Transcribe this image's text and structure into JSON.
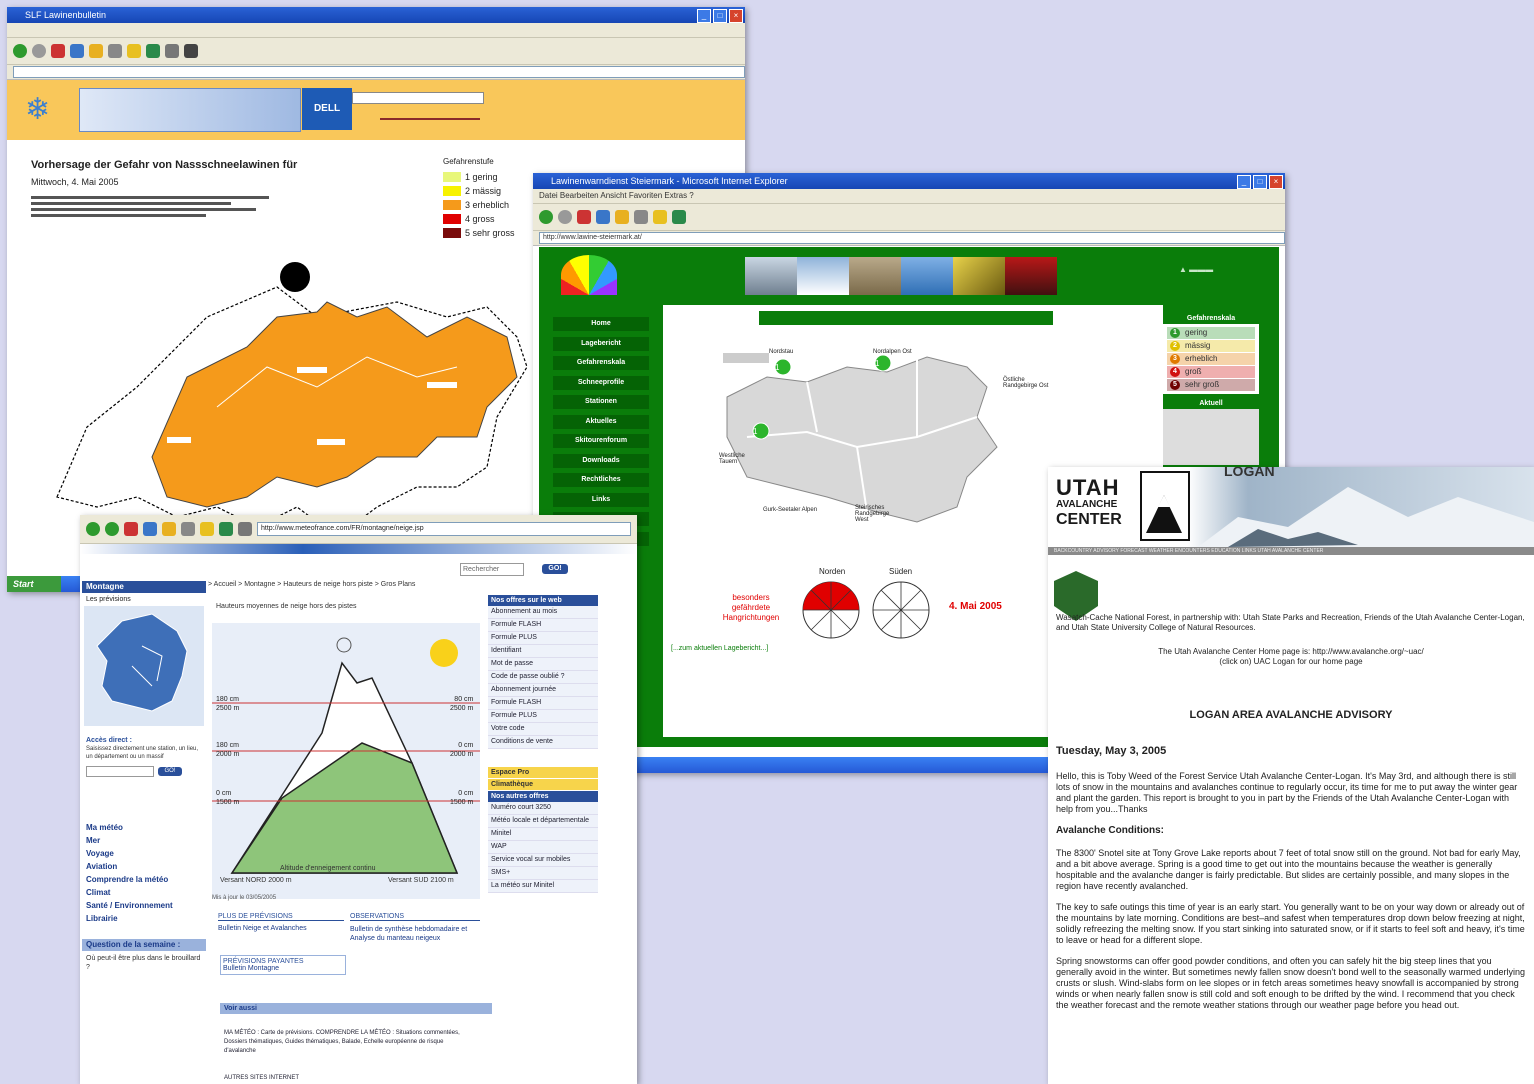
{
  "w1": {
    "title_bar": "SLF Lawinenbulletin",
    "map_title": "Vorhersage der Gefahr von Nassschneelawinen für",
    "map_subtitle": "Mittwoch, 4. Mai 2005",
    "legend_title": "Gefahrenstufe",
    "legend": [
      {
        "label": "1 gering",
        "color": "#e8f77a"
      },
      {
        "label": "2 mässig",
        "color": "#f7f200"
      },
      {
        "label": "3 erheblich",
        "color": "#f59a1b"
      },
      {
        "label": "4 gross",
        "color": "#e00000"
      },
      {
        "label": "5 sehr gross",
        "color": "#7a0b0b"
      }
    ],
    "region_color": "#f59a1b",
    "start_label": "Start"
  },
  "w2": {
    "title_bar": "Lawinenwarndienst Steiermark - Microsoft Internet Explorer",
    "menu": "Datei  Bearbeiten  Ansicht  Favoriten  Extras  ?",
    "address": "http://www.lawine-steiermark.at/",
    "nav": [
      "Home",
      "Lagebericht",
      "Gefahrenskala",
      "Schneeprofile",
      "Stationen",
      "Aktuelles",
      "Skitourenforum",
      "Downloads",
      "Rechtliches",
      "Links",
      "Team",
      "Kontakt"
    ],
    "gefahr_title": "Gefahrenskala",
    "gefahr_levels": [
      {
        "num": "1",
        "label": "gering",
        "color": "#2c9a2c"
      },
      {
        "num": "2",
        "label": "mässig",
        "color": "#e0c000"
      },
      {
        "num": "3",
        "label": "erheblich",
        "color": "#e07a00"
      },
      {
        "num": "4",
        "label": "groß",
        "color": "#d01010"
      },
      {
        "num": "5",
        "label": "sehr groß",
        "color": "#700000"
      }
    ],
    "aktuell_label": "Aktuell",
    "north_label": "Norden",
    "south_label": "Süden",
    "special_label": "besonders gefährdete Hangrichtungen",
    "date": "4. Mai 2005",
    "link": "[...zum aktuellen Lagebericht...]",
    "region_labels": [
      "Nordstau",
      "Nordalpen Ost",
      "Westliche Tauern",
      "Östliche Randgebirge Ost",
      "Gurk-Seetaler Alpen",
      "Steirisches Randgebirge West"
    ],
    "accent": "#0a7d0a",
    "danger_color": "#e00000"
  },
  "w3": {
    "address": "http://www.meteofrance.com/FR/montagne/neige.jsp",
    "search_placeholder": "Rechercher",
    "go": "GO!",
    "breadcrumb": "> Accueil > Montagne > Hauteurs de neige hors piste > Gros Plans",
    "section_title": "Hauteurs moyennes de neige hors des pistes",
    "left_header": "Montagne",
    "left_sub": "Les prévisions",
    "acces_title": "Accès direct :",
    "acces_text": "Saisissez directement une station, un lieu, un département ou un massif",
    "left_links": [
      "Ma météo",
      "Mer",
      "Voyage",
      "Aviation",
      "Comprendre la météo",
      "Climat",
      "Santé / Environnement",
      "Librairie"
    ],
    "question_header": "Question de la semaine :",
    "question_text": "Où peut-il être plus dans le brouillard ?",
    "levels_left": [
      "180 cm",
      "2500 m",
      "180 cm",
      "2000 m",
      "0 cm",
      "1500 m"
    ],
    "levels_right": [
      "80 cm",
      "2500 m",
      "0 cm",
      "2000 m",
      "0 cm",
      "1500 m"
    ],
    "versant_note": "Altitude d'enneigement continu",
    "versant_nord": "Versant NORD 2000 m",
    "versant_sud": "Versant SUD 2100 m",
    "update": "Mis à jour le 03/05/2005",
    "plus_title": "PLUS DE PRÉVISIONS",
    "plus_link": "Bulletin Neige et Avalanches",
    "obs_title": "OBSERVATIONS",
    "obs_link": "Bulletin de synthèse hebdomadaire et Analyse du manteau neigeux",
    "payantes_title": "PRÉVISIONS PAYANTES",
    "payantes_link": "Bulletin Montagne",
    "voir_title": "Voir aussi",
    "voir_text": "MA MÉTÉO : Carte de prévisions. COMPRENDRE LA MÉTÉO : Situations commentées, Dossiers thématiques, Guides thématiques, Balade, Echelle européenne de risque d'avalanche",
    "right_header": "Nos offres sur le web",
    "right_rows": [
      "Abonnement au mois",
      "Formule FLASH",
      "Formule PLUS",
      "Identifiant",
      "Mot de passe",
      "Code de passe oublié ?",
      "Abonnement journée",
      "Formule FLASH",
      "Formule PLUS",
      "Votre code",
      "Conditions de vente"
    ],
    "espace_pro": "Espace Pro",
    "climatheque": "Climathèque",
    "autres_header": "Nos autres offres",
    "autres": [
      "Numéro court 3250",
      "Météo locale et départementale",
      "Minitel",
      "WAP",
      "Service vocal sur mobiles",
      "SMS+",
      "La météo sur Minitel"
    ],
    "autres_sites": "AUTRES SITES INTERNET"
  },
  "w4": {
    "top_label": "LOGAN",
    "logo_line1": "UTAH",
    "logo_line2": "AVALANCHE",
    "logo_line3": "CENTER",
    "nav": "BACKCOUNTRY ADVISORY FORECAST WEATHER ENCOUNTERS EDUCATION LINKS UTAH AVALANCHE CENTER",
    "partner_text": "Wasatch-Cache National Forest, in partnership with: Utah State Parks and Recreation, Friends of the Utah Avalanche Center-Logan, and Utah State University College of Natural Resources.",
    "home_line": "The Utah Avalanche Center Home page is: http://www.avalanche.org/~uac/",
    "click_line": "(click on) UAC Logan for our home page",
    "heading": "LOGAN AREA AVALANCHE ADVISORY",
    "date": "Tuesday, May 3, 2005",
    "p1": "Hello, this is Toby Weed of the Forest Service Utah Avalanche Center-Logan. It's May 3rd, and although there is still lots of snow in the mountains and avalanches continue to regularly occur, its time for me to put away the winter gear and plant the garden. This report is brought to you in part by the Friends of the Utah Avalanche Center-Logan with help from you...Thanks",
    "cond_title": "Avalanche Conditions:",
    "p2": "The 8300' Snotel site at Tony Grove Lake reports about 7 feet of total snow still on the ground. Not bad for early May, and a bit above average. Spring is a good time to get out into the mountains because the weather is generally hospitable and the avalanche danger is fairly predictable. But slides are certainly possible, and many slopes in the region have recently avalanched.",
    "p3": "The key to safe outings this time of year is an early start. You generally want to be on your way down or already out of the mountains by late morning. Conditions are best–and safest when temperatures drop down below freezing at night, solidly refreezing the melting snow. If you start sinking into saturated snow, or if it starts to feel soft and heavy, it's time to leave or head for a different slope.",
    "p4": "Spring snowstorms can offer good powder conditions, and often you can safely hit the big steep lines that you generally avoid in the winter. But sometimes newly fallen snow doesn't bond well to the seasonally warmed underlying crusts or slush. Wind-slabs form on lee slopes or in fetch areas sometimes heavy snowfall is accompanied by strong winds or when nearly fallen snow is still cold and soft enough to be drifted by the wind. I recommend that you check the weather forecast and the remote weather stations through our weather page before you head out.",
    "link_color": "#1a1aa8"
  }
}
